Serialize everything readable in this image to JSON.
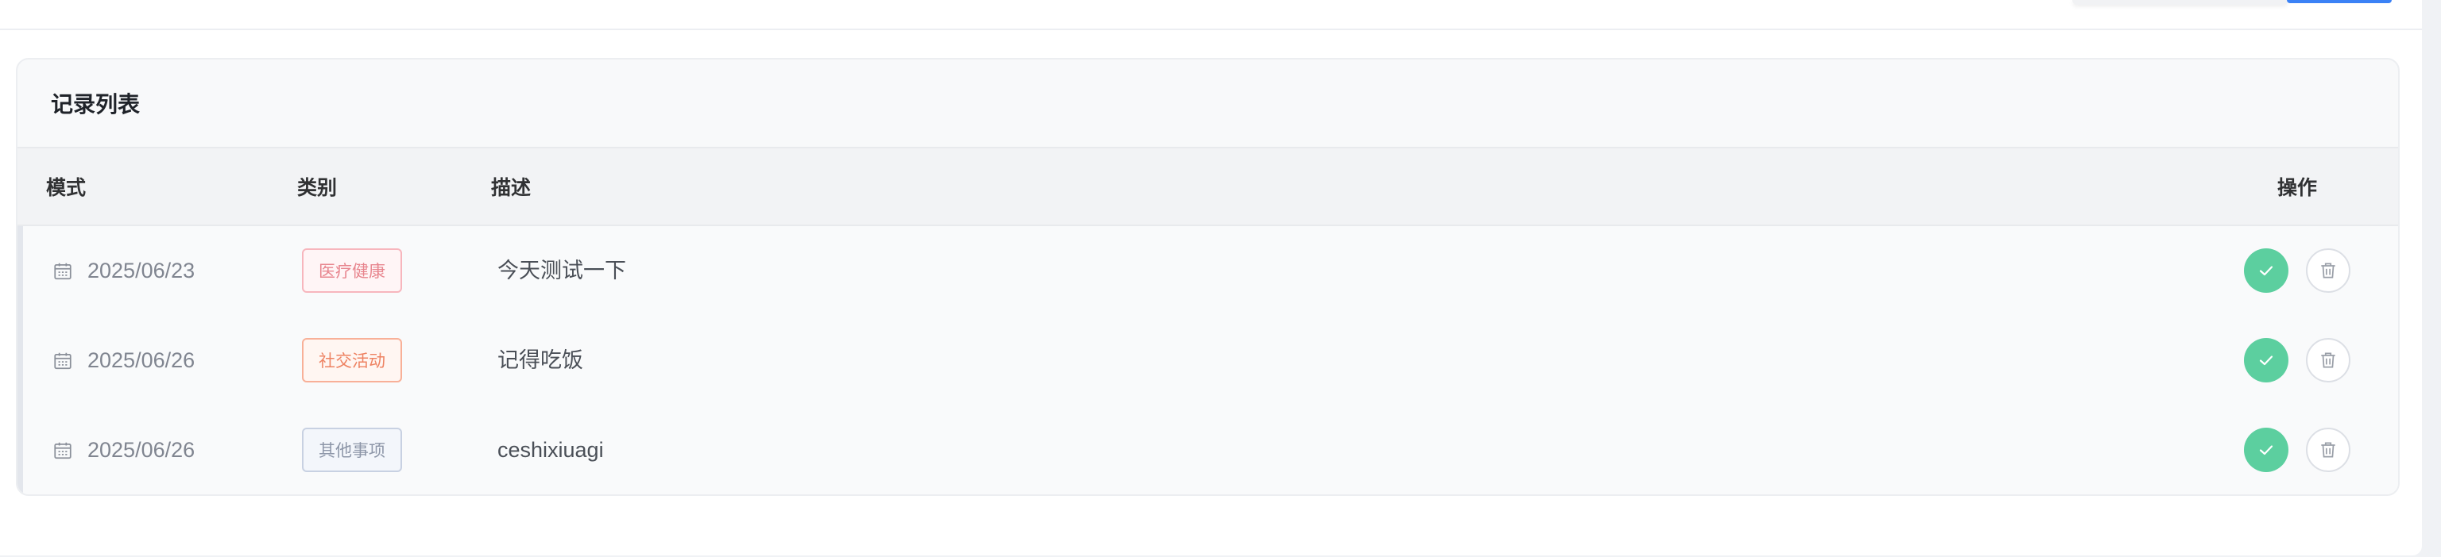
{
  "card": {
    "title": "记录列表"
  },
  "table": {
    "headers": {
      "mode": "模式",
      "category": "类别",
      "description": "描述",
      "actions": "操作"
    },
    "rows": [
      {
        "date": "2025/06/23",
        "category": "医疗健康",
        "category_color": "#e8868f",
        "description": "今天测试一下"
      },
      {
        "date": "2025/06/26",
        "category": "社交活动",
        "category_color": "#ee8262",
        "description": "记得吃饭"
      },
      {
        "date": "2025/06/26",
        "category": "其他事项",
        "category_color": "#8d96a8",
        "description": "ceshixiuagi"
      }
    ]
  },
  "icons": {
    "date": "calendar-icon",
    "confirm": "check-icon",
    "delete": "trash-icon"
  },
  "colors": {
    "confirm_button": "#5ccf9f",
    "primary_button": "#3b82f6"
  }
}
